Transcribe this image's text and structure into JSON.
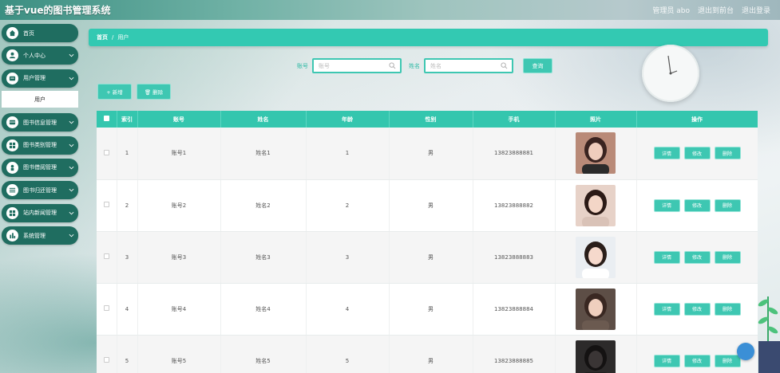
{
  "app": {
    "title": "基于vue的图书管理系统"
  },
  "header": {
    "links": [
      "管理员 abo",
      "退出到前台",
      "退出登录"
    ]
  },
  "sidebar": {
    "items": [
      {
        "label": "首页",
        "icon": "home-icon",
        "has_chevron": false
      },
      {
        "label": "个人中心",
        "icon": "user-icon",
        "has_chevron": true
      },
      {
        "label": "用户管理",
        "icon": "list-icon",
        "has_chevron": true,
        "expanded": true,
        "sub": [
          "用户"
        ]
      },
      {
        "label": "图书信息管理",
        "icon": "book-icon",
        "has_chevron": true
      },
      {
        "label": "图书类别管理",
        "icon": "grid-icon",
        "has_chevron": true
      },
      {
        "label": "图书借阅管理",
        "icon": "person-icon",
        "has_chevron": true
      },
      {
        "label": "图书归还管理",
        "icon": "sliders-icon",
        "has_chevron": true
      },
      {
        "label": "站内新闻管理",
        "icon": "grid-icon",
        "has_chevron": true
      },
      {
        "label": "系统管理",
        "icon": "chart-icon",
        "has_chevron": true
      }
    ]
  },
  "breadcrumb": {
    "home": "首页",
    "separator": "/",
    "current": "用户"
  },
  "search": {
    "account_label": "账号",
    "account_placeholder": "账号",
    "name_label": "姓名",
    "name_placeholder": "姓名",
    "query_button": "查询"
  },
  "actions": {
    "add": "+ 新增",
    "delete": "🗑 删除"
  },
  "table": {
    "columns": [
      "",
      "索引",
      "账号",
      "姓名",
      "年龄",
      "性别",
      "手机",
      "照片",
      "操作"
    ],
    "rows": [
      {
        "index": "1",
        "account": "账号1",
        "name": "姓名1",
        "age": "1",
        "gender": "男",
        "phone": "13823888881"
      },
      {
        "index": "2",
        "account": "账号2",
        "name": "姓名2",
        "age": "2",
        "gender": "男",
        "phone": "13823888882"
      },
      {
        "index": "3",
        "account": "账号3",
        "name": "姓名3",
        "age": "3",
        "gender": "男",
        "phone": "13823888883"
      },
      {
        "index": "4",
        "account": "账号4",
        "name": "姓名4",
        "age": "4",
        "gender": "男",
        "phone": "13823888884"
      },
      {
        "index": "5",
        "account": "账号5",
        "name": "姓名5",
        "age": "5",
        "gender": "男",
        "phone": "13823888885"
      }
    ],
    "row_actions": [
      "详情",
      "修改",
      "删除"
    ]
  },
  "colors": {
    "accent": "#3ec7b2",
    "sidebar": "#1f6d60",
    "header_bar": "#34c6ae"
  }
}
